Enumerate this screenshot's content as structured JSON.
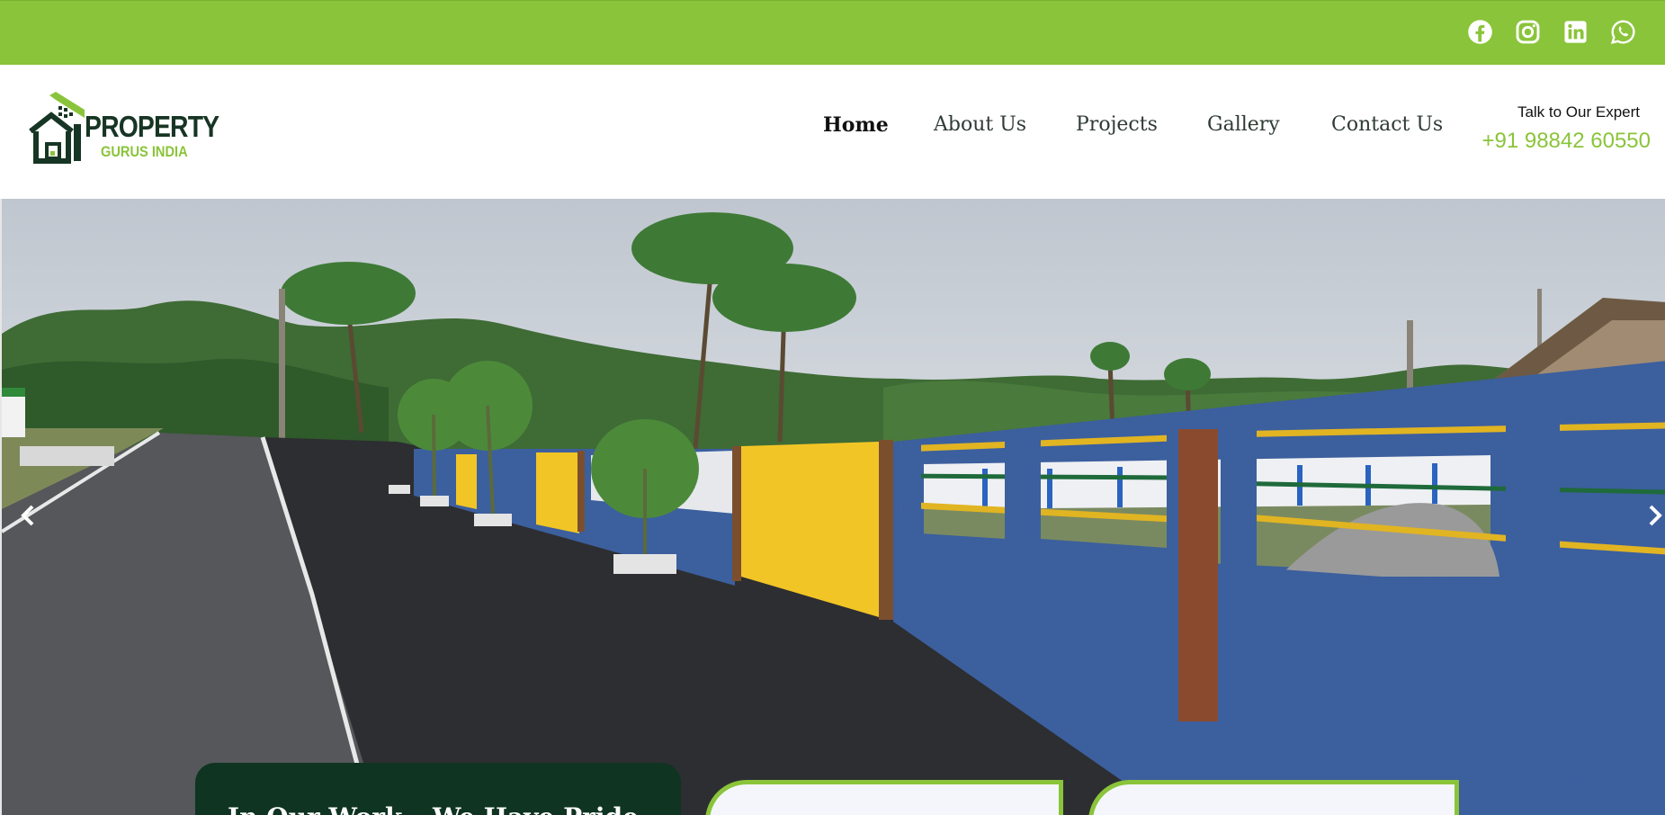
{
  "social": {
    "icons": [
      "facebook-icon",
      "instagram-icon",
      "linkedin-icon",
      "whatsapp-icon"
    ]
  },
  "brand": {
    "name_line1": "PROPERTY",
    "name_line2": "GURUS INDIA",
    "colors": {
      "green": "#8ac43a",
      "dark": "#173524"
    }
  },
  "nav": {
    "items": [
      {
        "label": "Home",
        "active": true
      },
      {
        "label": "About Us",
        "active": false
      },
      {
        "label": "Projects",
        "active": false
      },
      {
        "label": "Gallery",
        "active": false
      },
      {
        "label": "Contact Us",
        "active": false
      }
    ]
  },
  "expert": {
    "label": "Talk to Our Expert",
    "phone": "+91 98842 60550"
  },
  "hero": {
    "caption": "In Our Work – We Have Pride"
  },
  "colors": {
    "topbar": "#8ac43a",
    "caption_bg": "#0f3421",
    "accent": "#8ac43a"
  }
}
